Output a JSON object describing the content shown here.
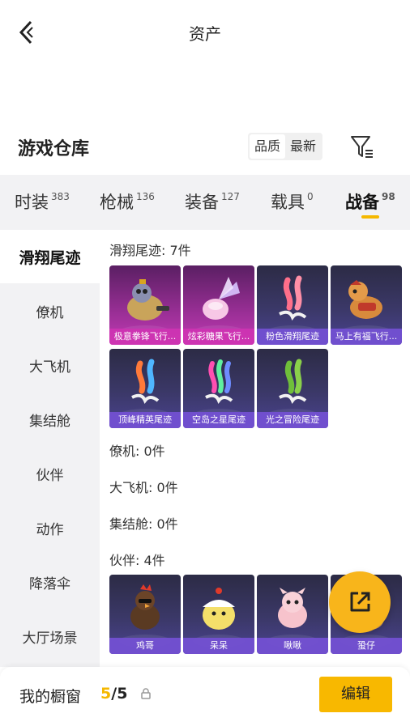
{
  "header": {
    "title": "资产"
  },
  "warehouse": {
    "title": "游戏仓库",
    "sort_options": [
      "品质",
      "最新"
    ],
    "sort_selected": "品质"
  },
  "tabs": [
    {
      "label": "时装",
      "count": "383"
    },
    {
      "label": "枪械",
      "count": "136"
    },
    {
      "label": "装备",
      "count": "127"
    },
    {
      "label": "载具",
      "count": "0"
    },
    {
      "label": "战备",
      "count": "98",
      "active": true
    }
  ],
  "sidebar": {
    "items": [
      "滑翔尾迹",
      "僚机",
      "大飞机",
      "集结舱",
      "伙伴",
      "动作",
      "降落伞",
      "大厅场景"
    ],
    "active": "滑翔尾迹"
  },
  "sections": {
    "trails": {
      "header": "滑翔尾迹: 7件",
      "items": [
        {
          "name": "极意拳锋飞行...",
          "rarity": "pink",
          "icon": "cat-rider-icon"
        },
        {
          "name": "炫彩糖果飞行...",
          "rarity": "pink",
          "icon": "candy-wing-icon"
        },
        {
          "name": "粉色滑翔尾迹",
          "rarity": "purple",
          "icon": "pink-trail-icon"
        },
        {
          "name": "马上有福飞行...",
          "rarity": "purple",
          "icon": "horse-icon"
        },
        {
          "name": "顶峰精英尾迹",
          "rarity": "purple",
          "icon": "elite-trail-icon"
        },
        {
          "name": "空岛之星尾迹",
          "rarity": "purple",
          "icon": "rainbow-trail-icon"
        },
        {
          "name": "光之冒险尾迹",
          "rarity": "purple",
          "icon": "green-trail-icon"
        }
      ]
    },
    "wingman": {
      "header": "僚机: 0件"
    },
    "big_plane": {
      "header": "大飞机: 0件"
    },
    "capsule": {
      "header": "集结舱: 0件"
    },
    "partners": {
      "header": "伙伴: 4件",
      "items": [
        {
          "name": "鸡哥",
          "icon": "rooster-icon"
        },
        {
          "name": "呆呆",
          "icon": "chick-icon"
        },
        {
          "name": "啾啾",
          "icon": "pink-pet-icon"
        },
        {
          "name": "蛩仔",
          "icon": "pet-icon"
        }
      ]
    }
  },
  "showcase": {
    "label": "我的橱窗",
    "current": "5",
    "slash": "/",
    "max": "5",
    "edit_label": "编辑"
  },
  "colors": {
    "accent": "#f8b800",
    "rarity_pink": "#ce34b2",
    "rarity_purple": "#7350d2"
  }
}
